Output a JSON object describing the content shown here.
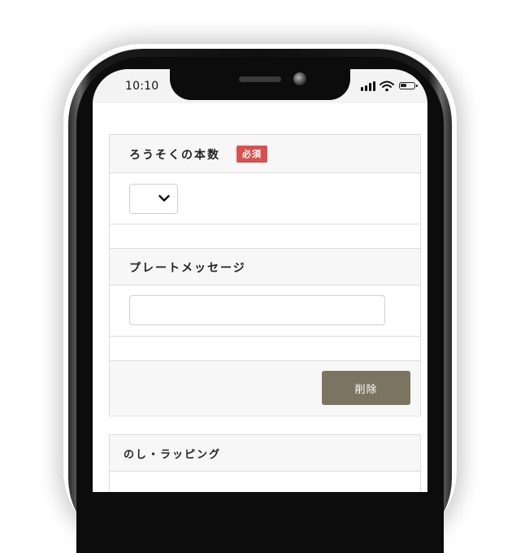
{
  "status_bar": {
    "time": "10:10"
  },
  "candles": {
    "title": "ろうそくの本数",
    "required_badge": "必須",
    "selected_value": ""
  },
  "plate_message": {
    "title": "プレートメッセージ",
    "input_value": "",
    "input_placeholder": ""
  },
  "delete_button": {
    "label": "削除"
  },
  "noshi": {
    "title": "のし・ラッピング"
  },
  "colors": {
    "required_badge": "#d9514e",
    "delete_button": "#7b7460",
    "section_header_bg": "#f7f7f7",
    "border": "#dddddd"
  },
  "icons": [
    "signal-icon",
    "wifi-icon",
    "battery-icon",
    "chevron-down-icon",
    "camera-icon",
    "speaker-icon"
  ]
}
